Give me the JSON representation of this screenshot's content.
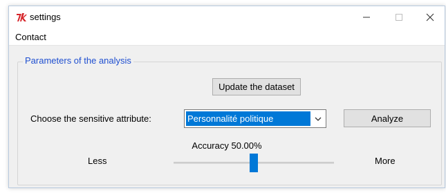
{
  "window": {
    "title": "settings",
    "controls": {
      "minimize": "—",
      "maximize": "☐",
      "close": "✕"
    }
  },
  "menu": {
    "items": [
      "Contact"
    ]
  },
  "group": {
    "legend": "Parameters of the analysis",
    "update_button": "Update the dataset",
    "attribute_label": "Choose the sensitive attribute:",
    "attribute_selected": "Personnalité politique",
    "analyze_button": "Analyze",
    "accuracy_text": "Accuracy 50.00%",
    "slider": {
      "less_label": "Less",
      "more_label": "More",
      "value": 0.5
    }
  },
  "colors": {
    "accent": "#0078d7",
    "legend_text": "#1f4fd0",
    "icon_red": "#d6252a"
  },
  "icons": {
    "app": "tk-feather-icon",
    "dropdown": "chevron-down-icon"
  }
}
